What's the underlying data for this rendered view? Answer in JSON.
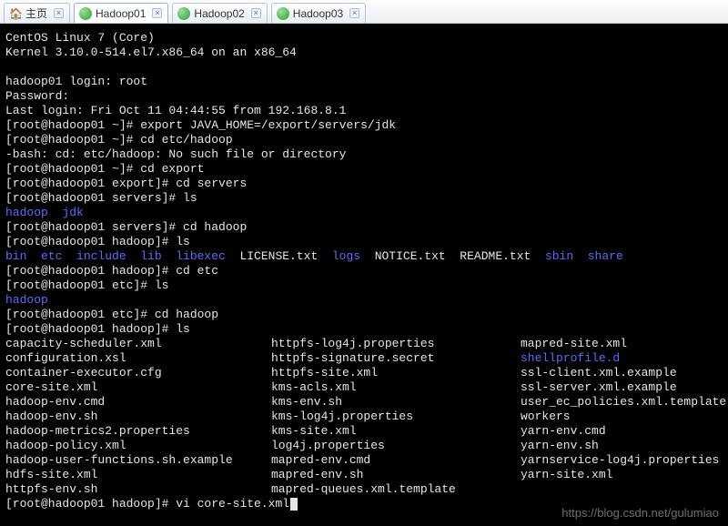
{
  "tabs": [
    {
      "label": "主页",
      "icon": "home"
    },
    {
      "label": "Hadoop01",
      "icon": "host",
      "active": true
    },
    {
      "label": "Hadoop02",
      "icon": "host"
    },
    {
      "label": "Hadoop03",
      "icon": "host"
    }
  ],
  "term": {
    "os_line": "CentOS Linux 7 (Core)",
    "kernel_line": "Kernel 3.10.0-514.el7.x86_64 on an x86_64",
    "login_prompt": "hadoop01 login: root",
    "password_prompt": "Password:",
    "last_login": "Last login: Fri Oct 11 04:44:55 from 192.168.8.1",
    "p1": "[root@hadoop01 ~]# export JAVA_HOME=/export/servers/jdk",
    "p2": "[root@hadoop01 ~]# cd etc/hadoop",
    "err1": "-bash: cd: etc/hadoop: No such file or directory",
    "p3": "[root@hadoop01 ~]# cd export",
    "p4": "[root@hadoop01 export]# cd servers",
    "p5": "[root@hadoop01 servers]# ls",
    "ls1_a": "hadoop  ",
    "ls1_b": "jdk",
    "p6": "[root@hadoop01 servers]# cd hadoop",
    "p7": "[root@hadoop01 hadoop]# ls",
    "ls2": {
      "s1": "bin  etc  include  lib  libexec",
      "s2": "  LICENSE.txt  ",
      "s3": "logs",
      "s4": "  NOTICE.txt  README.txt  ",
      "s5": "sbin  share"
    },
    "p8": "[root@hadoop01 hadoop]# cd etc",
    "p9": "[root@hadoop01 etc]# ls",
    "ls3": "hadoop",
    "p10": "[root@hadoop01 etc]# cd hadoop",
    "p11": "[root@hadoop01 hadoop]# ls",
    "files": {
      "col1": [
        "capacity-scheduler.xml",
        "configuration.xsl",
        "container-executor.cfg",
        "core-site.xml",
        "hadoop-env.cmd",
        "hadoop-env.sh",
        "hadoop-metrics2.properties",
        "hadoop-policy.xml",
        "hadoop-user-functions.sh.example",
        "hdfs-site.xml",
        "httpfs-env.sh",
        "[root@hadoop01 hadoop]# vi core-site.xml"
      ],
      "col2": [
        "httpfs-log4j.properties",
        "httpfs-signature.secret",
        "httpfs-site.xml",
        "kms-acls.xml",
        "kms-env.sh",
        "kms-log4j.properties",
        "kms-site.xml",
        "log4j.properties",
        "mapred-env.cmd",
        "mapred-env.sh",
        "mapred-queues.xml.template"
      ],
      "col3": [
        "mapred-site.xml",
        "shellprofile.d",
        "ssl-client.xml.example",
        "ssl-server.xml.example",
        "user_ec_policies.xml.template",
        "workers",
        "yarn-env.cmd",
        "yarn-env.sh",
        "yarnservice-log4j.properties",
        "yarn-site.xml"
      ],
      "col3_blue_index": 1
    },
    "watermark": "https://blog.csdn.net/gulumiao"
  }
}
